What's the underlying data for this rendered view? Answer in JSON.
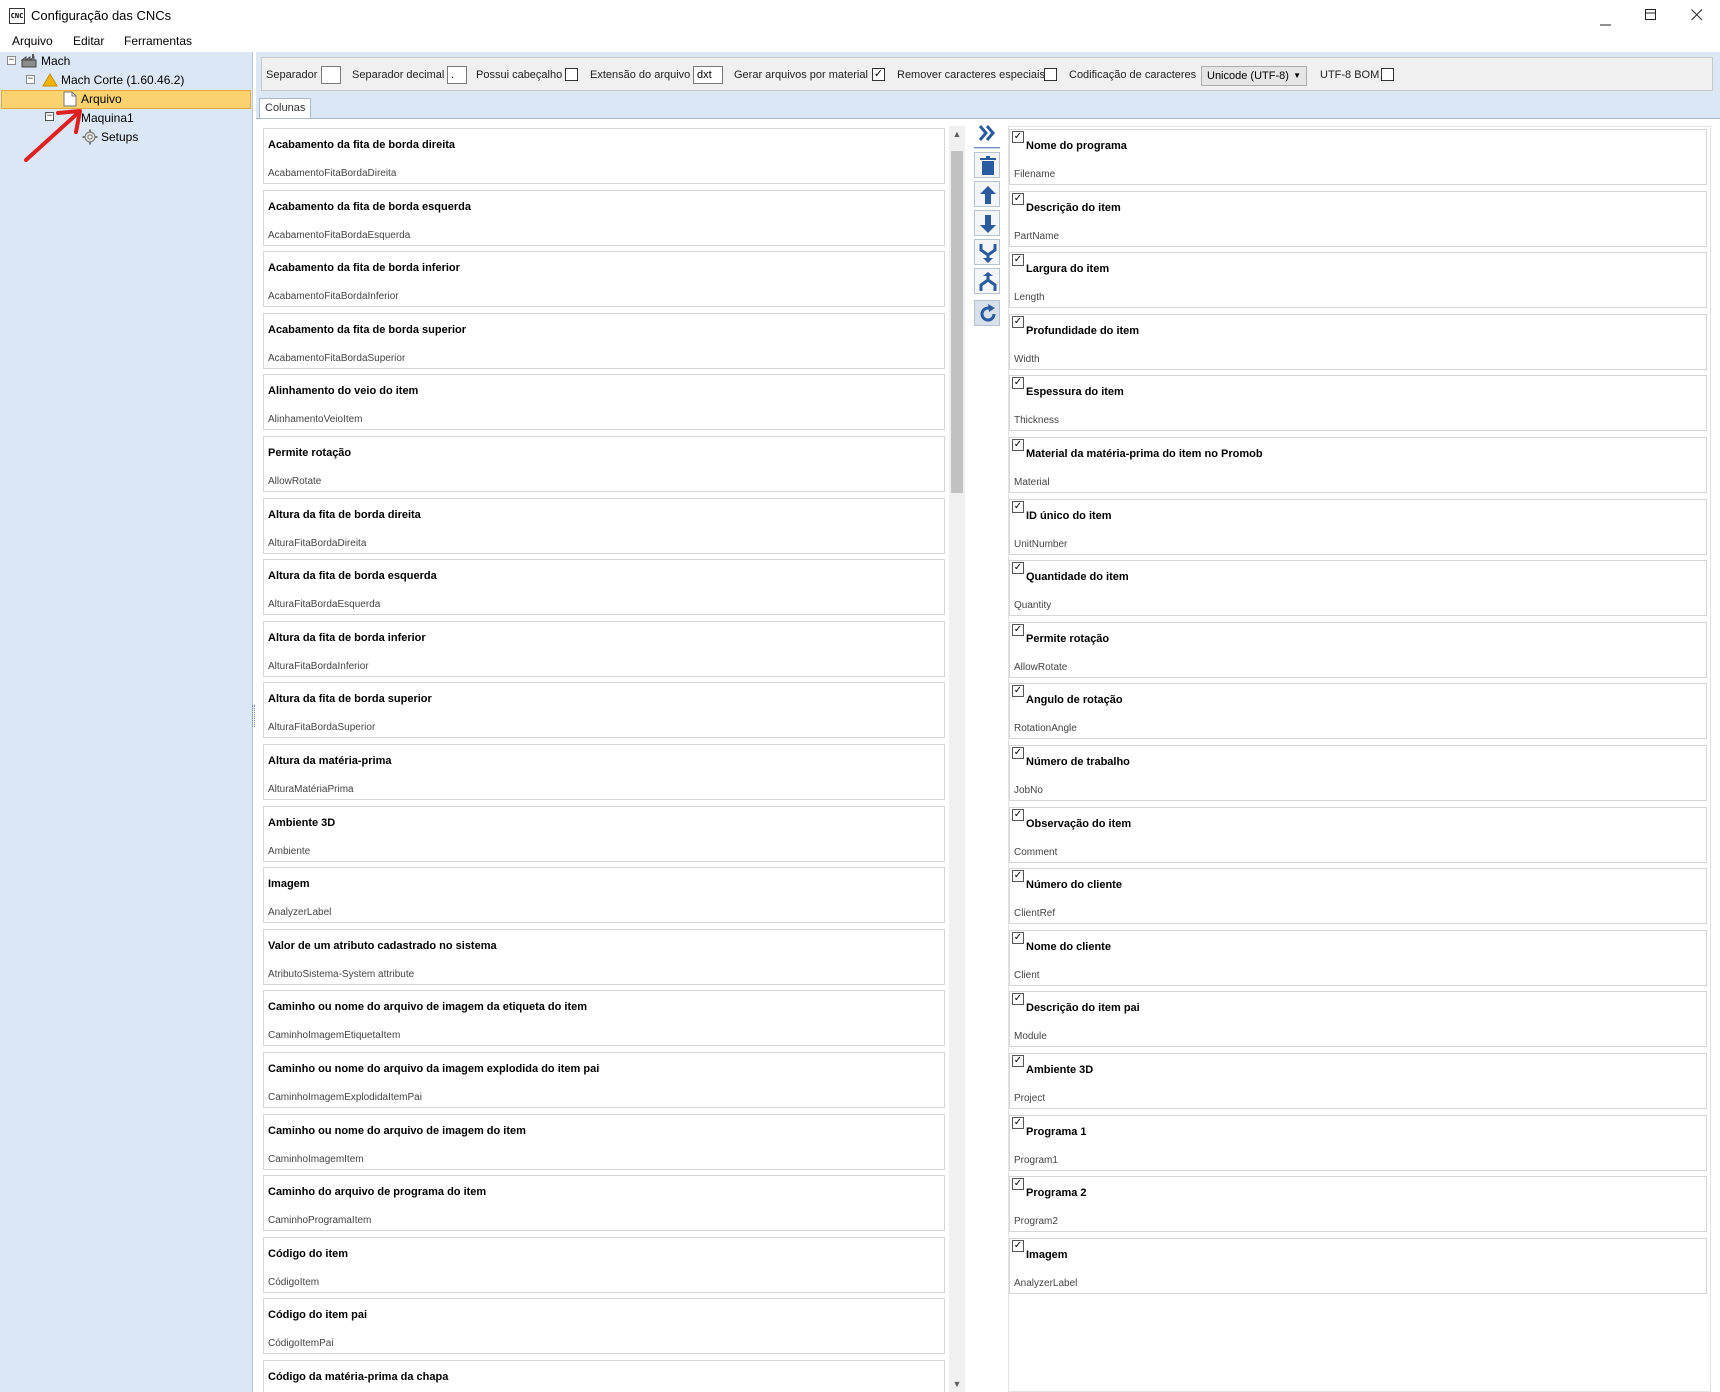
{
  "window": {
    "title": "Configuração das CNCs",
    "icon_text": "CNC",
    "minimize": "—",
    "maximize": "☐",
    "close": "✕"
  },
  "menu": [
    "Arquivo",
    "Editar",
    "Ferramentas"
  ],
  "tree": {
    "root": "Mach",
    "machine": "Mach Corte (1.60.46.2)",
    "file_node": "Arquivo",
    "machine1": "Maquina1",
    "setups": "Setups"
  },
  "options": {
    "separator_label": "Separador",
    "separator_value": "",
    "decimal_label": "Separador decimal",
    "decimal_value": ".",
    "header_label": "Possui cabeçalho",
    "header_checked": false,
    "extension_label": "Extensão do arquivo",
    "extension_value": "dxt",
    "per_material_label": "Gerar arquivos por material",
    "per_material_checked": true,
    "remove_special_label": "Remover caracteres especiais",
    "remove_special_checked": false,
    "encoding_label": "Codificação de caracteres",
    "encoding_value": "Unicode (UTF-8)",
    "bom_label": "UTF-8 BOM",
    "bom_checked": false
  },
  "tab": "Colunas",
  "available_columns": [
    {
      "title": "Acabamento da fita de borda direita",
      "key": "AcabamentoFitaBordaDireita"
    },
    {
      "title": "Acabamento da fita de borda esquerda",
      "key": "AcabamentoFitaBordaEsquerda"
    },
    {
      "title": "Acabamento da fita de borda inferior",
      "key": "AcabamentoFitaBordaInferior"
    },
    {
      "title": "Acabamento da fita de borda superior",
      "key": "AcabamentoFitaBordaSuperior"
    },
    {
      "title": "Alinhamento do veio do item",
      "key": "AlinhamentoVeioItem"
    },
    {
      "title": "Permite rotação",
      "key": "AllowRotate"
    },
    {
      "title": "Altura da fita de borda direita",
      "key": "AlturaFitaBordaDireita"
    },
    {
      "title": "Altura da fita de borda esquerda",
      "key": "AlturaFitaBordaEsquerda"
    },
    {
      "title": "Altura da fita de borda inferior",
      "key": "AlturaFitaBordaInferior"
    },
    {
      "title": "Altura da fita de borda superior",
      "key": "AlturaFitaBordaSuperior"
    },
    {
      "title": "Altura da matéria-prima",
      "key": "AlturaMatériaPrima"
    },
    {
      "title": "Ambiente 3D",
      "key": "Ambiente"
    },
    {
      "title": "Imagem",
      "key": "AnalyzerLabel"
    },
    {
      "title": "Valor de um atributo cadastrado no sistema",
      "key": "AtributoSistema-System attribute"
    },
    {
      "title": "Caminho ou nome do arquivo de imagem da etiqueta do item",
      "key": "CaminhoImagemEtiquetaItem"
    },
    {
      "title": "Caminho ou nome do arquivo da imagem explodida do item pai",
      "key": "CaminhoImagemExplodidaItemPai"
    },
    {
      "title": "Caminho ou nome do arquivo de imagem do item",
      "key": "CaminhoImagemItem"
    },
    {
      "title": "Caminho do arquivo de programa do item",
      "key": "CaminhoProgramaItem"
    },
    {
      "title": "Código do item",
      "key": "CódigoItem"
    },
    {
      "title": "Código do item pai",
      "key": "CódigoItemPai"
    },
    {
      "title": "Código da matéria-prima da chapa",
      "key": ""
    }
  ],
  "selected_columns": [
    {
      "title": "Nome do programa",
      "key": "Filename",
      "checked": true
    },
    {
      "title": "Descrição do item",
      "key": "PartName",
      "checked": true
    },
    {
      "title": "Largura do item",
      "key": "Length",
      "checked": true
    },
    {
      "title": "Profundidade do item",
      "key": "Width",
      "checked": true
    },
    {
      "title": "Espessura do item",
      "key": "Thickness",
      "checked": true
    },
    {
      "title": "Material da matéria-prima do item no Promob",
      "key": "Material",
      "checked": true
    },
    {
      "title": "ID único do item",
      "key": "UnitNumber",
      "checked": true
    },
    {
      "title": "Quantidade do item",
      "key": "Quantity",
      "checked": true
    },
    {
      "title": "Permite rotação",
      "key": "AllowRotate",
      "checked": true
    },
    {
      "title": "Angulo de rotação",
      "key": "RotationAngle",
      "checked": true
    },
    {
      "title": "Número de trabalho",
      "key": "JobNo",
      "checked": true
    },
    {
      "title": "Observação do item",
      "key": "Comment",
      "checked": true
    },
    {
      "title": "Número do cliente",
      "key": "ClientRef",
      "checked": true
    },
    {
      "title": "Nome do cliente",
      "key": "Client",
      "checked": true
    },
    {
      "title": "Descrição do item pai",
      "key": "Module",
      "checked": true
    },
    {
      "title": "Ambiente 3D",
      "key": "Project",
      "checked": true
    },
    {
      "title": "Programa 1",
      "key": "Program1",
      "checked": true
    },
    {
      "title": "Programa 2",
      "key": "Program2",
      "checked": true
    },
    {
      "title": "Imagem",
      "key": "AnalyzerLabel",
      "checked": true
    }
  ],
  "toolbar_icons": [
    "add-all-icon",
    "delete-icon",
    "move-up-icon",
    "move-down-icon",
    "merge-icon",
    "split-icon",
    "refresh-icon"
  ]
}
